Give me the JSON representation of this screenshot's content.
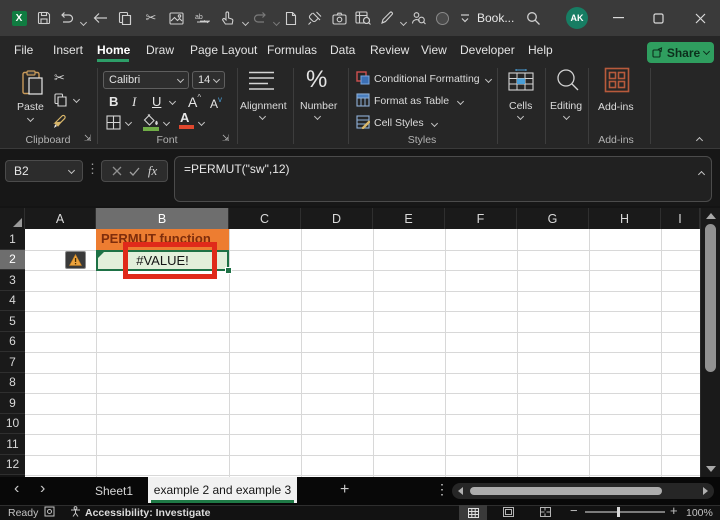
{
  "titlebar": {
    "title": "Book...",
    "avatar": "AK"
  },
  "menu": {
    "tabs": [
      "File",
      "Insert",
      "Home",
      "Draw",
      "Page Layout",
      "Formulas",
      "Data",
      "Review",
      "View",
      "Developer",
      "Help"
    ],
    "active_tab": "Home",
    "share_label": "Share"
  },
  "ribbon": {
    "paste_label": "Paste",
    "font_name": "Calibri",
    "font_size": "14",
    "bold": "B",
    "italic": "I",
    "underline": "U",
    "grow_font": "A",
    "shrink_font": "A",
    "alignment_label": "Alignment",
    "number_label": "Number",
    "percent": "%",
    "conditional_formatting": "Conditional Formatting",
    "format_as_table": "Format as Table",
    "cell_styles": "Cell Styles",
    "cells_label": "Cells",
    "editing_label": "Editing",
    "addins_label": "Add-ins",
    "group_clipboard": "Clipboard",
    "group_font": "Font",
    "group_styles": "Styles",
    "group_addins": "Add-ins"
  },
  "formula_bar": {
    "name_box": "B2",
    "fx": "fx",
    "formula": "=PERMUT(\"sw\",12)"
  },
  "grid": {
    "columns": [
      "A",
      "B",
      "C",
      "D",
      "E",
      "F",
      "G",
      "H",
      "I"
    ],
    "rows": [
      "1",
      "2",
      "3",
      "4",
      "5",
      "6",
      "7",
      "8",
      "9",
      "10",
      "11",
      "12"
    ],
    "selected_ref": "B2",
    "cell_b1": {
      "text": "PERMUT function",
      "fill": "#ED7D31",
      "text_color": "#7E2D0C"
    },
    "cell_b2": {
      "text": "#VALUE!",
      "fill": "#E2EFDA"
    },
    "annotation_color": "#E02A1A"
  },
  "sheet_tabs": {
    "tabs": [
      {
        "label": "Sheet1"
      },
      {
        "label": "example 2 and example 3"
      }
    ],
    "active": "example 2 and example 3"
  },
  "status_bar": {
    "mode": "Ready",
    "accessibility": "Accessibility: Investigate",
    "zoom_level": "100%"
  }
}
